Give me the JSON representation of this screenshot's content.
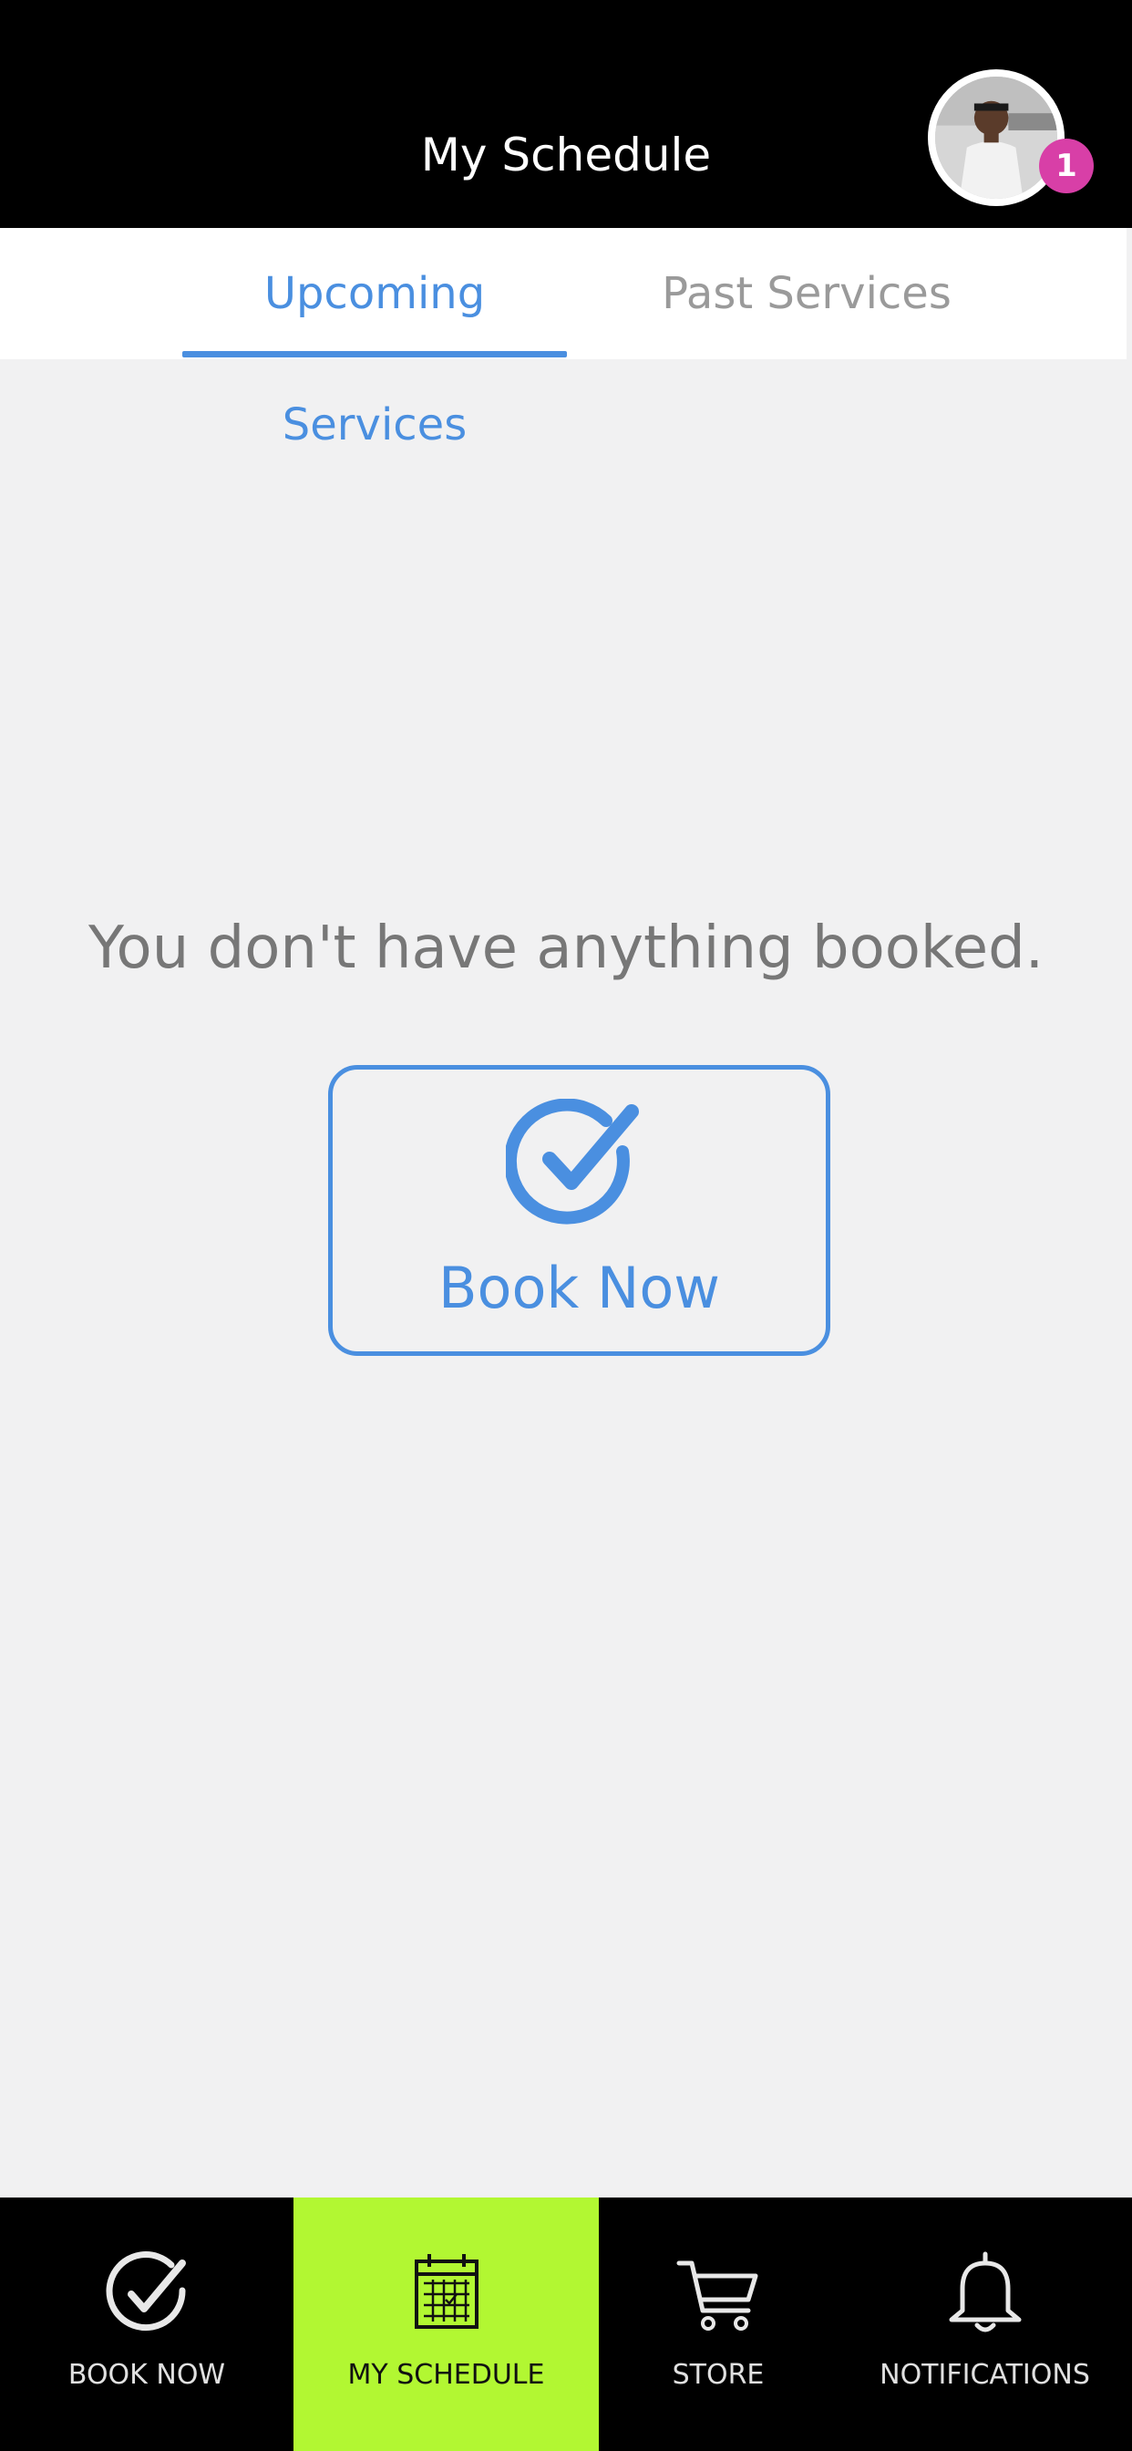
{
  "header": {
    "title": "My Schedule",
    "notification_badge": "1"
  },
  "tabs": {
    "upcoming": "Upcoming Services",
    "past": "Past Services",
    "active": "upcoming"
  },
  "empty_state": {
    "message": "You don't have anything booked.",
    "button_label": "Book Now"
  },
  "bottom_nav": {
    "items": [
      {
        "label": "BOOK NOW",
        "icon": "check-circle-icon"
      },
      {
        "label": "MY SCHEDULE",
        "icon": "calendar-icon",
        "active": true
      },
      {
        "label": "STORE",
        "icon": "cart-icon"
      },
      {
        "label": "NOTIFICATIONS",
        "icon": "bell-icon"
      }
    ]
  },
  "colors": {
    "header_bg": "#000000",
    "accent_blue": "#4a8fe0",
    "nav_active": "#b2f732",
    "badge": "#d83fa7",
    "page_bg": "#f1f1f2"
  }
}
